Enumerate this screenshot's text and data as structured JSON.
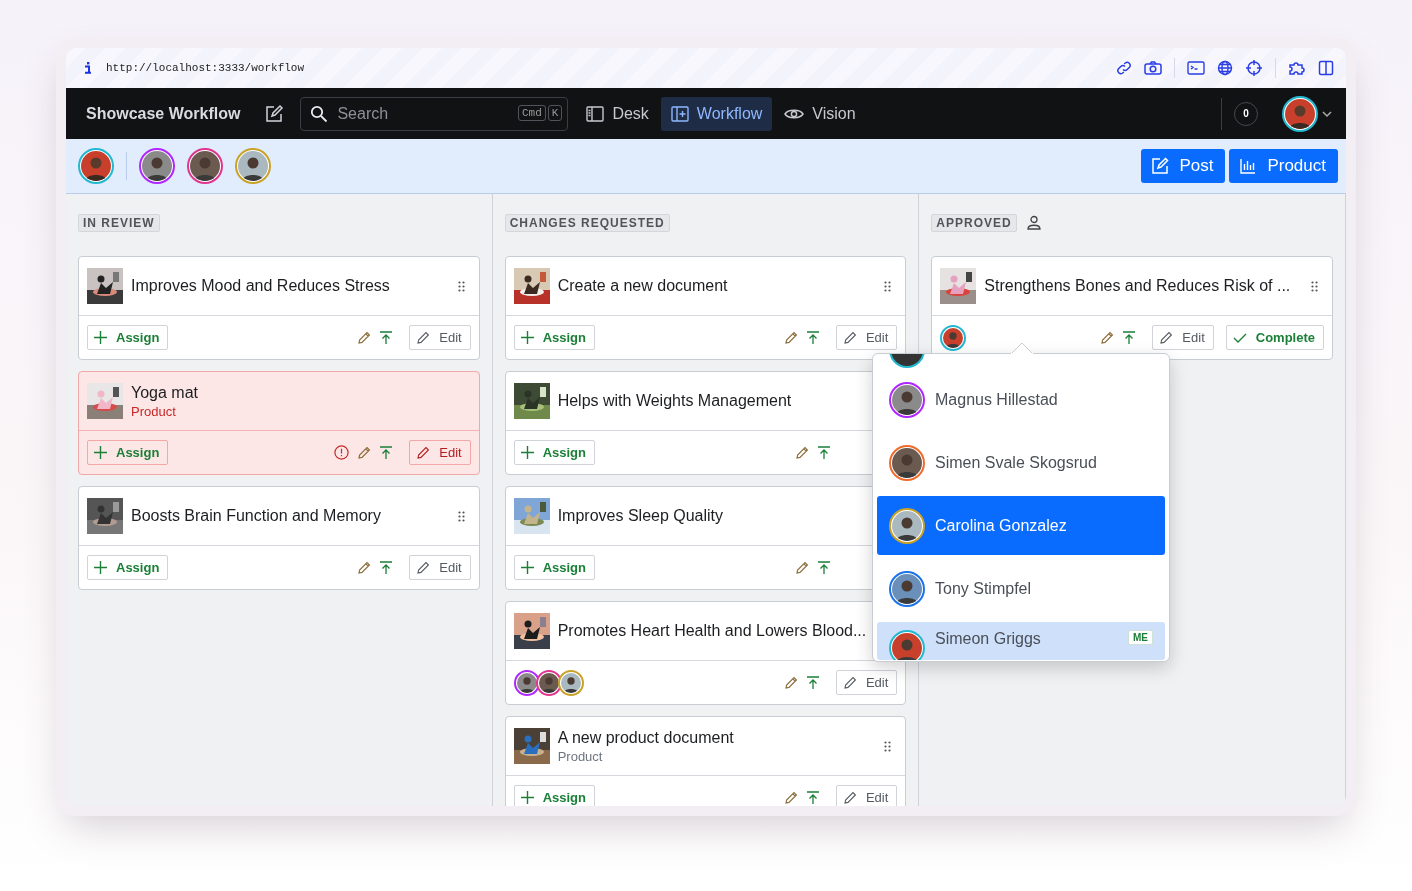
{
  "browser": {
    "url": "http://localhost:3333/workflow"
  },
  "navbar": {
    "title": "Showcase Workflow",
    "search": {
      "placeholder": "Search",
      "shortcut": [
        "Cmd",
        "K"
      ]
    },
    "tabs": [
      {
        "label": "Desk",
        "selected": false
      },
      {
        "label": "Workflow",
        "selected": true
      },
      {
        "label": "Vision",
        "selected": false
      }
    ],
    "notifications": "0",
    "user": {
      "color": "#22b8cf"
    }
  },
  "toolbar": {
    "current_user": {
      "color": "#22b8cf"
    },
    "avatars": [
      {
        "color": "#b026ff"
      },
      {
        "color": "#e0358f"
      },
      {
        "color": "#c9a227"
      }
    ],
    "buttons": [
      "Post",
      "Product"
    ]
  },
  "columns": [
    {
      "title": "IN REVIEW",
      "user_icon": false,
      "cards": [
        {
          "title": "Improves Mood and Reduces Stress",
          "error": false,
          "handle": true,
          "assign": "Assign",
          "edit": "Edit"
        },
        {
          "title": "Yoga mat",
          "subtitle": "Product",
          "error": true,
          "handle": false,
          "assign": "Assign",
          "edit": "Edit"
        },
        {
          "title": "Boosts Brain Function and Memory",
          "error": false,
          "handle": true,
          "assign": "Assign",
          "edit": "Edit"
        }
      ]
    },
    {
      "title": "CHANGES REQUESTED",
      "user_icon": false,
      "cards": [
        {
          "title": "Create a new document",
          "error": false,
          "handle": true,
          "assign": "Assign",
          "edit": "Edit"
        },
        {
          "title": "Helps with Weights Management",
          "error": false,
          "handle": false,
          "assign": "Assign"
        },
        {
          "title": "Improves Sleep Quality",
          "error": false,
          "handle": false,
          "assign": "Assign"
        },
        {
          "title": "Promotes Heart Health and Lowers Blood...",
          "error": false,
          "handle": false,
          "assignees": [
            {
              "color": "#b026ff"
            },
            {
              "color": "#e0358f"
            },
            {
              "color": "#c9a227"
            }
          ],
          "edit": "Edit"
        },
        {
          "title": "A new product document",
          "subtitle": "Product",
          "error": false,
          "handle": true,
          "assign": "Assign",
          "edit": "Edit"
        }
      ]
    },
    {
      "title": "APPROVED",
      "user_icon": true,
      "cards": [
        {
          "title": "Strengthens Bones and Reduces Risk of ...",
          "error": false,
          "handle": true,
          "assignees": [
            {
              "color": "#22b8cf"
            }
          ],
          "edit": "Edit",
          "complete": "Complete"
        }
      ]
    }
  ],
  "people_menu": {
    "items": [
      {
        "name": "Magnus Hillestad",
        "color": "#b026ff",
        "selected": false,
        "hovered": false
      },
      {
        "name": "Simen Svale Skogsrud",
        "color": "#f06a2a",
        "selected": false,
        "hovered": false
      },
      {
        "name": "Carolina Gonzalez",
        "color": "#c9a227",
        "selected": true,
        "hovered": false
      },
      {
        "name": "Tony Stimpfel",
        "color": "#1a73e8",
        "selected": false,
        "hovered": false
      },
      {
        "name": "Simeon Griggs",
        "color": "#22b8cf",
        "selected": false,
        "hovered": true,
        "badge": "ME"
      }
    ]
  }
}
